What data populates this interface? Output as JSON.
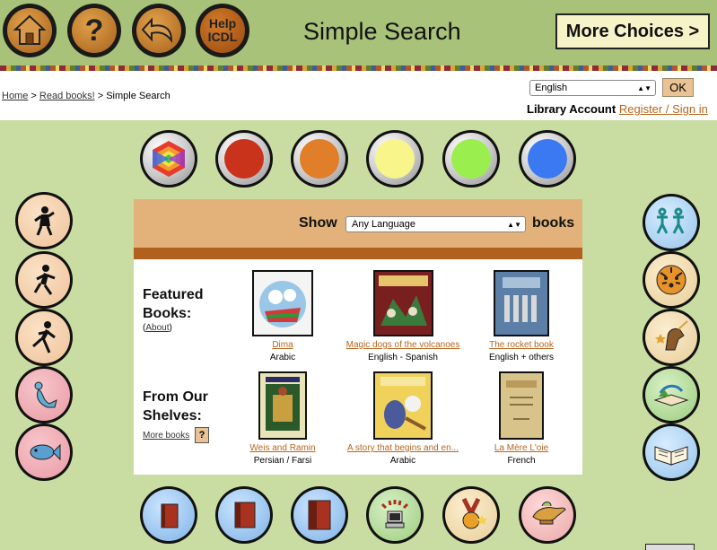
{
  "header": {
    "title": "Simple Search",
    "more_choices": "More Choices >",
    "help_label_1": "Help",
    "help_label_2": "ICDL",
    "home_icon": "home-icon",
    "question_icon": "question-icon",
    "back_icon": "back-arrow-icon"
  },
  "breadcrumb": {
    "home": "Home",
    "sep1": " > ",
    "read_books": "Read books!",
    "sep2": " > Simple Search"
  },
  "language": {
    "selected": "English",
    "ok": "OK"
  },
  "account": {
    "label": "Library Account",
    "link": "Register / Sign in"
  },
  "colors": {
    "red": "#c9331b",
    "orange": "#e07e2a",
    "yellow": "#f8f58a",
    "green": "#9aef4e",
    "blue": "#3a79f2"
  },
  "show": {
    "label": "Show",
    "selected": "Any Language",
    "suffix": "books"
  },
  "featured": {
    "heading_line1": "Featured",
    "heading_line2": "Books:",
    "about_open": "(",
    "about": "About",
    "about_close": ")",
    "books": [
      {
        "title": "Dima",
        "language": "Arabic"
      },
      {
        "title": "Magic dogs of the volcanoes",
        "language": "English - Spanish"
      },
      {
        "title": "The rocket book",
        "language": "English + others"
      }
    ]
  },
  "shelves": {
    "heading_line1": "From Our",
    "heading_line2": "Shelves:",
    "more_books": "More books",
    "help": "?",
    "books": [
      {
        "title": "Weis and Ramin",
        "language": "Persian / Farsi"
      },
      {
        "title": "A story that begins and en...",
        "language": "Arabic"
      },
      {
        "title": "La Mère L'oie",
        "language": "French"
      }
    ]
  },
  "left_icons": [
    "small-child-icon",
    "running-child-icon",
    "running-adult-icon",
    "mermaid-icon",
    "fish-icon"
  ],
  "right_icons": [
    "dancing-figures-icon",
    "tiger-icon",
    "unicorn-icon",
    "picture-book-icon",
    "open-book-icon"
  ],
  "bottom_icons": [
    "short-book-icon",
    "medium-book-icon",
    "long-book-icon",
    "computer-icon",
    "award-medal-icon",
    "magic-lamp-icon"
  ]
}
